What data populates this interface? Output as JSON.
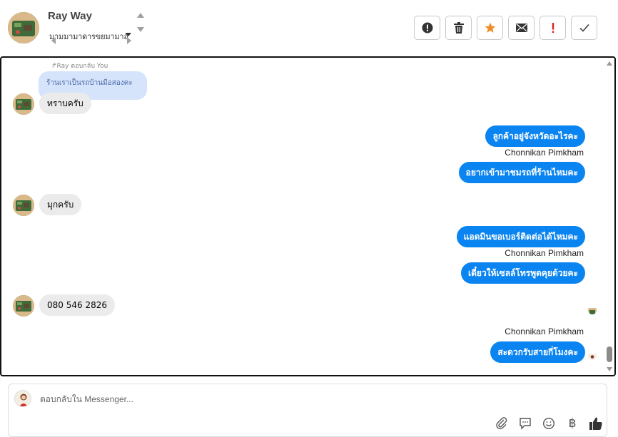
{
  "header": {
    "contact_name": "Ray Way",
    "subtitle": "มามมามาดารขยมามาอั",
    "actions": [
      {
        "name": "report-button",
        "icon": "alert-circle-icon"
      },
      {
        "name": "delete-button",
        "icon": "trash-icon"
      },
      {
        "name": "star-button",
        "icon": "star-icon"
      },
      {
        "name": "mail-button",
        "icon": "envelope-icon"
      },
      {
        "name": "important-button",
        "icon": "exclamation-icon"
      },
      {
        "name": "done-button",
        "icon": "check-icon"
      }
    ]
  },
  "chat": {
    "reply_note": "↱Ray ตอบกลับ You",
    "reply_quote": "ร้านเราเป็นรถบ้านมือสองคะ",
    "messages": [
      {
        "from": "in",
        "text": "ทราบครับ"
      },
      {
        "from": "out",
        "text": "ลูกค้าอยู่จังหวัดอะไรคะ"
      },
      {
        "from": "out-sender",
        "text": "Chonnikan Pimkham"
      },
      {
        "from": "out",
        "text": "อยากเข้ามาชมรถที่ร้านไหมคะ"
      },
      {
        "from": "in",
        "text": "มุกครับ"
      },
      {
        "from": "out",
        "text": "แอดมินขอเบอร์ติดต่อได้ไหมคะ"
      },
      {
        "from": "out-sender",
        "text": "Chonnikan Pimkham"
      },
      {
        "from": "out",
        "text": "เดี๋ยวให้เซลล์โทรพูดคุยด้วยคะ"
      },
      {
        "from": "in",
        "text": "080 546 2826"
      },
      {
        "from": "out-sender",
        "text": "Chonnikan Pimkham"
      },
      {
        "from": "out",
        "text": "สะดวกรับสายกี่โมงคะ"
      }
    ]
  },
  "composer": {
    "placeholder": "ตอบกลับใน Messenger...",
    "tools": [
      "paperclip-icon",
      "comment-icon",
      "emoji-icon",
      "baht-icon",
      "thumbs-up-icon"
    ]
  },
  "colors": {
    "outgoing_bubble": "#0a84f0",
    "incoming_bubble": "#ebebeb",
    "star_accent": "#f28c28",
    "important_accent": "#e02020"
  }
}
